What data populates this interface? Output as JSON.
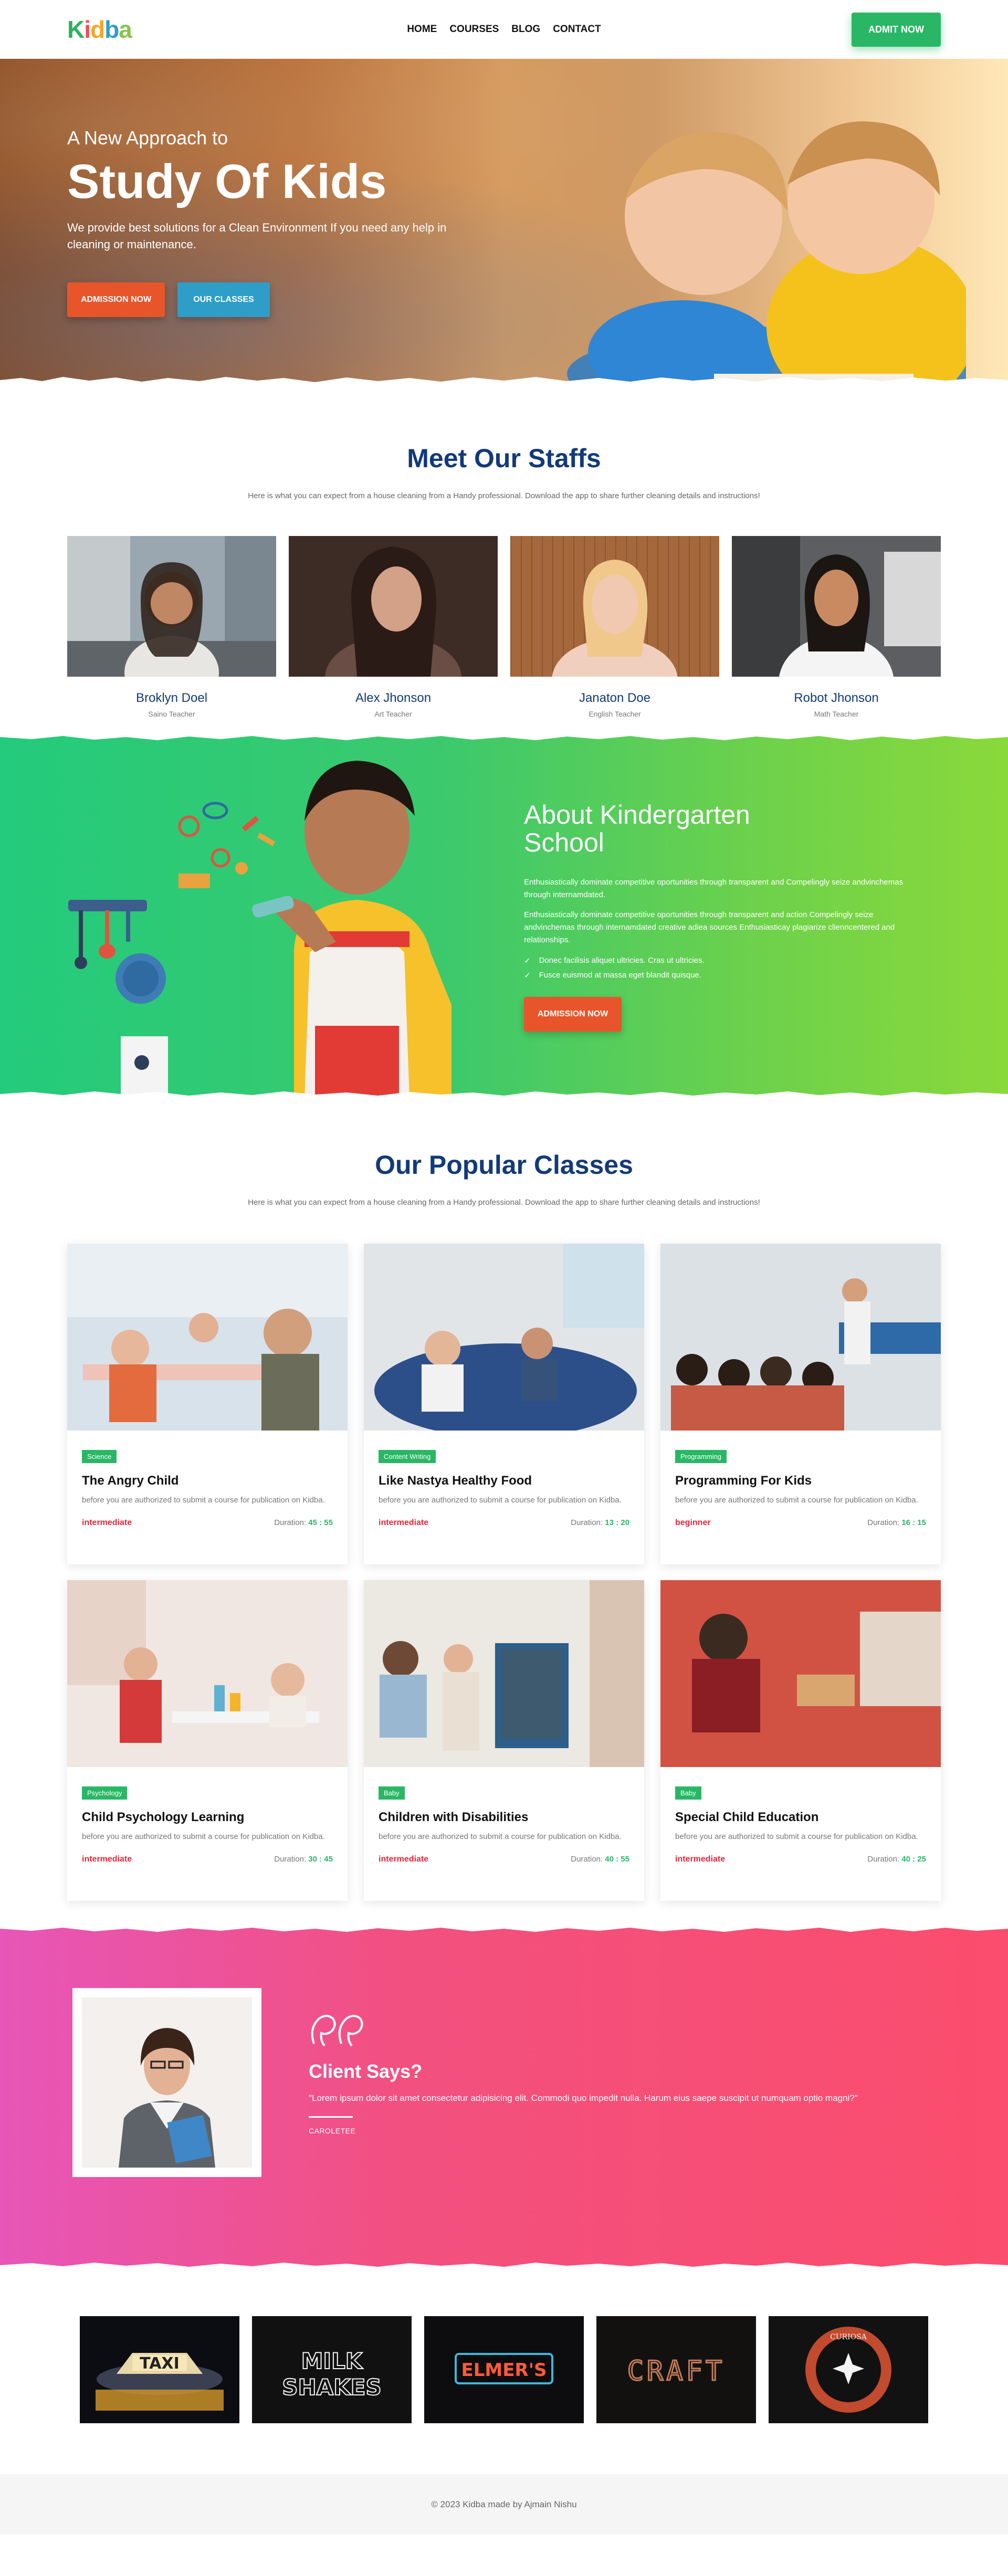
{
  "navbar": {
    "logo_letters": [
      "K",
      "i",
      "d",
      "b",
      "a"
    ],
    "logo_colors": [
      "#2cb25b",
      "#f04e4e",
      "#f5a623",
      "#2e9ec9",
      "#8bc34a"
    ],
    "links": [
      "HOME",
      "COURSES",
      "BLOG",
      "CONTACT"
    ],
    "admit_label": "ADMIT NOW"
  },
  "hero": {
    "subtitle": "A New Approach to",
    "title": "Study Of Kids",
    "text": "We provide best solutions for a Clean Environment If you need any help in cleaning or maintenance.",
    "btn_admission": "ADMISSION NOW",
    "btn_classes": "OUR CLASSES"
  },
  "staffs": {
    "title": "Meet Our Staffs",
    "subtitle": "Here is what you can expect from a house cleaning from a Handy professional. Download the app to share further cleaning details and instructions!",
    "members": [
      {
        "name": "Broklyn Doel",
        "role": "Saino Teacher"
      },
      {
        "name": "Alex Jhonson",
        "role": "Art Teacher"
      },
      {
        "name": "Janaton Doe",
        "role": "English Teacher"
      },
      {
        "name": "Robot Jhonson",
        "role": "Math Teacher"
      }
    ]
  },
  "about": {
    "title_line1": "About Kindergarten",
    "title_line2": "School",
    "p1": "Enthusiastically dominate competitive oportunities through transparent and Compelingly seize andvinchemas through internamdated.",
    "p2": "Enthusiastically dominate competitive oportunities through transparent and action Compelingly seize andvinchemas through internamdated creative adiea sources Enthusiasticay plagiarize clienncentered and relationships.",
    "list": [
      "Donec facilisis aliquet ultricies. Cras ut ultricies.",
      "Fusce euismod at massa eget blandit quisque."
    ],
    "btn": "ADMISSION NOW"
  },
  "classes": {
    "title": "Our Popular Classes",
    "subtitle": "Here is what you can expect from a house cleaning from a Handy professional. Download the app to share further cleaning details and instructions!",
    "duration_label": "Duration:",
    "items": [
      {
        "tag": "Science",
        "title": "The Angry Child",
        "desc": "before you are authorized to submit a course for publication on Kidba.",
        "level": "intermediate",
        "duration": "45 : 55"
      },
      {
        "tag": "Content Writing",
        "title": "Like Nastya Healthy Food",
        "desc": "before you are authorized to submit a course for publication on Kidba.",
        "level": "intermediate",
        "duration": "13 : 20"
      },
      {
        "tag": "Programming",
        "title": "Programming For Kids",
        "desc": "before you are authorized to submit a course for publication on Kidba.",
        "level": "beginner",
        "duration": "16 : 15"
      },
      {
        "tag": "Psychology",
        "title": "Child Psychology Learning",
        "desc": "before you are authorized to submit a course for publication on Kidba.",
        "level": "intermediate",
        "duration": "30 : 45"
      },
      {
        "tag": "Baby",
        "title": "Children with Disabilities",
        "desc": "before you are authorized to submit a course for publication on Kidba.",
        "level": "intermediate",
        "duration": "40 : 55"
      },
      {
        "tag": "Baby",
        "title": "Special Child Education",
        "desc": "before you are authorized to submit a course for publication on Kidba.",
        "level": "intermediate",
        "duration": "40 : 25"
      }
    ]
  },
  "testimonial": {
    "title": "Client Says?",
    "quote": "\"Lorem ipsum dolor sit amet consectetur adipisicing elit. Commodi quo impedit nulla. Harum eius saepe suscipit ut numquam optio magni?\"",
    "name": "CAROLETEE"
  },
  "brands": {
    "items": [
      "TAXI",
      "MILK SHAKES",
      "ELMER'S",
      "CRAFT",
      "CURIOSA"
    ]
  },
  "footer": {
    "text": "© 2023 Kidba made by Ajmain Nishu"
  }
}
